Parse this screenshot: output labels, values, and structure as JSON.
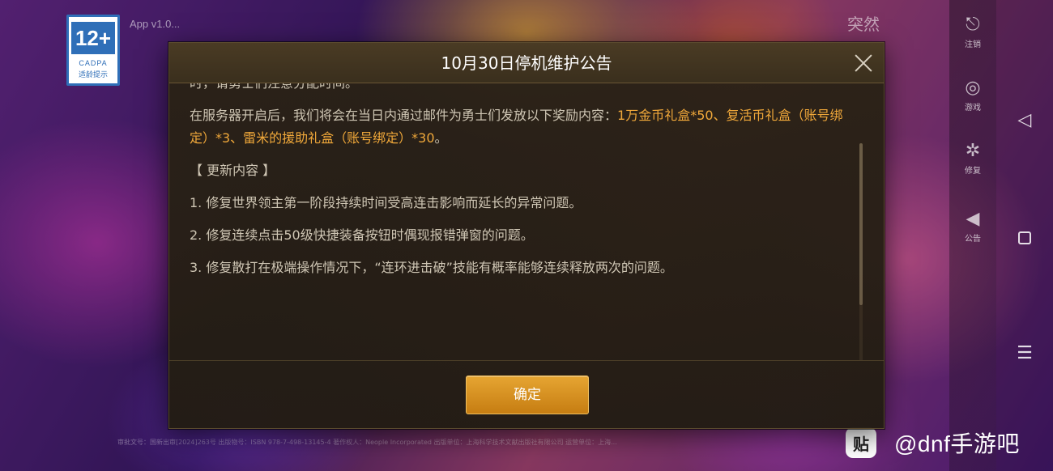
{
  "app": {
    "age_rating": "12+",
    "age_rating_org": "CADPA",
    "age_rating_tip": "适龄提示",
    "version_text": "App v1.0...",
    "top_right_text": "突然"
  },
  "side_menu": [
    {
      "icon": "logout-icon",
      "label": "注销"
    },
    {
      "icon": "record-icon",
      "label": "游戏"
    },
    {
      "icon": "repair-icon",
      "label": "修复"
    },
    {
      "icon": "announcement-icon",
      "label": "公告"
    }
  ],
  "dialog": {
    "title": "10月30日停机维护公告",
    "close_icon": "close-icon",
    "cut_line": "时，请勇士们注意分配时间。",
    "reward_intro": "在服务器开启后，我们将会在当日内通过邮件为勇士们发放以下奖励内容：",
    "reward_items": "1万金币礼盒*50、复活币礼盒（账号绑定）*3、雷米的援助礼盒（账号绑定）*30",
    "reward_end": "。",
    "section_header": "【 更新内容 】",
    "items": [
      "1. 修复世界领主第一阶段持续时间受高连击影响而延长的异常问题。",
      "2. 修复连续点击50级快捷装备按钮时偶现报错弹窗的问题。",
      "3. 修复散打在极端操作情况下，“连环进击破”技能有概率能够连续释放两次的问题。"
    ],
    "confirm_label": "确定"
  },
  "legal_text": "审批文号：国新出审[2024]263号  出版物号：ISBN 978-7-498-13145-4  著作权人：Neople Incorporated  出版单位：上海科学技术文献出版社有限公司  运营单位：上海...",
  "watermark": {
    "logo": "贴",
    "text": "@dnf手游吧"
  },
  "colors": {
    "accent_gold": "#f0a83a",
    "button_gold": "#e6a532"
  }
}
